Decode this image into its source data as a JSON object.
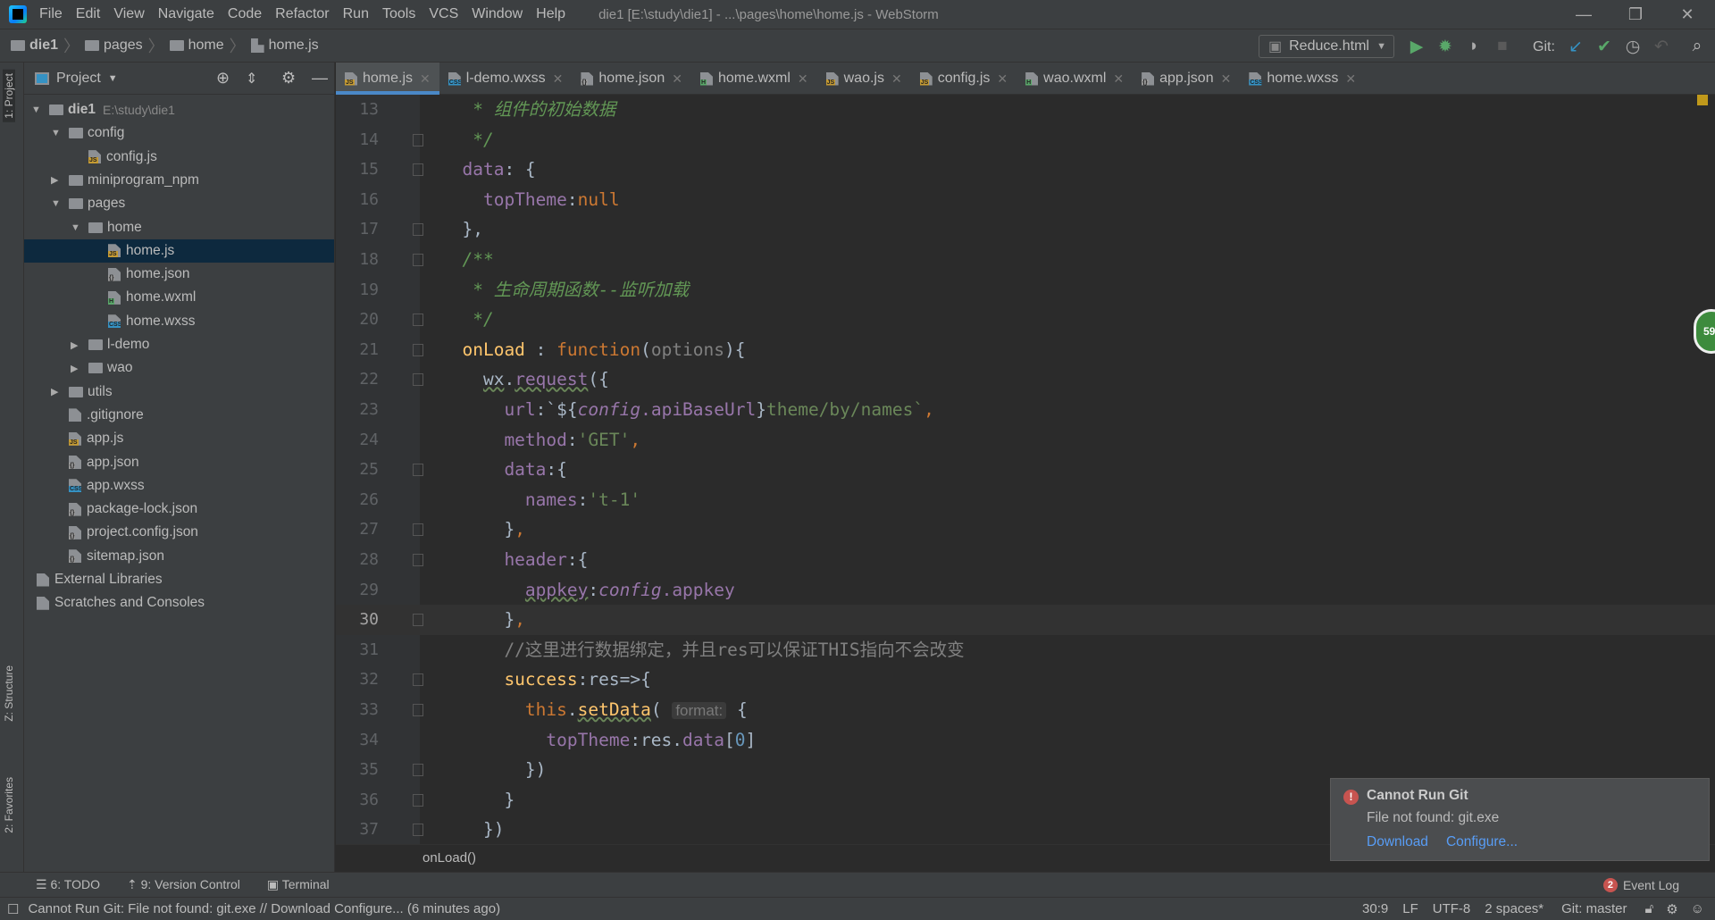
{
  "app": {
    "menus": [
      "File",
      "Edit",
      "View",
      "Navigate",
      "Code",
      "Refactor",
      "Run",
      "Tools",
      "VCS",
      "Window",
      "Help"
    ],
    "title": "die1 [E:\\study\\die1] - ...\\pages\\home\\home.js - WebStorm"
  },
  "breadcrumb": [
    "die1",
    "pages",
    "home",
    "home.js"
  ],
  "toolbar": {
    "run_config": "Reduce.html",
    "git_label": "Git:"
  },
  "side_tabs": {
    "project": "1: Project",
    "structure": "Z: Structure",
    "favorites": "2: Favorites"
  },
  "project": {
    "title": "Project",
    "items": [
      {
        "label": "die1",
        "hint": "E:\\study\\die1",
        "depth": 0,
        "kind": "folder",
        "arrow": "open",
        "bold": true
      },
      {
        "label": "config",
        "depth": 1,
        "kind": "folder",
        "arrow": "open"
      },
      {
        "label": "config.js",
        "depth": 2,
        "kind": "js"
      },
      {
        "label": "miniprogram_npm",
        "depth": 1,
        "kind": "folder",
        "arrow": "closed"
      },
      {
        "label": "pages",
        "depth": 1,
        "kind": "folder",
        "arrow": "open"
      },
      {
        "label": "home",
        "depth": 2,
        "kind": "folder",
        "arrow": "open"
      },
      {
        "label": "home.js",
        "depth": 3,
        "kind": "js",
        "selected": true
      },
      {
        "label": "home.json",
        "depth": 3,
        "kind": "json"
      },
      {
        "label": "home.wxml",
        "depth": 3,
        "kind": "wxml"
      },
      {
        "label": "home.wxss",
        "depth": 3,
        "kind": "css"
      },
      {
        "label": "l-demo",
        "depth": 2,
        "kind": "folder",
        "arrow": "closed"
      },
      {
        "label": "wao",
        "depth": 2,
        "kind": "folder",
        "arrow": "closed"
      },
      {
        "label": "utils",
        "depth": 1,
        "kind": "folder",
        "arrow": "closed"
      },
      {
        "label": ".gitignore",
        "depth": 1,
        "kind": "file"
      },
      {
        "label": "app.js",
        "depth": 1,
        "kind": "js"
      },
      {
        "label": "app.json",
        "depth": 1,
        "kind": "json"
      },
      {
        "label": "app.wxss",
        "depth": 1,
        "kind": "css"
      },
      {
        "label": "package-lock.json",
        "depth": 1,
        "kind": "json"
      },
      {
        "label": "project.config.json",
        "depth": 1,
        "kind": "json"
      },
      {
        "label": "sitemap.json",
        "depth": 1,
        "kind": "json"
      },
      {
        "label": "External Libraries",
        "depth": 0,
        "kind": "lib"
      },
      {
        "label": "Scratches and Consoles",
        "depth": 0,
        "kind": "scratch"
      }
    ]
  },
  "tabs": [
    {
      "label": "home.js",
      "kind": "js",
      "active": true
    },
    {
      "label": "l-demo.wxss",
      "kind": "css"
    },
    {
      "label": "home.json",
      "kind": "json"
    },
    {
      "label": "home.wxml",
      "kind": "wxml"
    },
    {
      "label": "wao.js",
      "kind": "js"
    },
    {
      "label": "config.js",
      "kind": "js"
    },
    {
      "label": "wao.wxml",
      "kind": "wxml"
    },
    {
      "label": "app.json",
      "kind": "json"
    },
    {
      "label": "home.wxss",
      "kind": "css"
    }
  ],
  "code": {
    "current_line": 30,
    "lines": [
      {
        "n": 13,
        "t": [
          [
            "   * 组件的初始数据",
            "d"
          ]
        ]
      },
      {
        "n": 14,
        "t": [
          [
            "   */",
            "d"
          ]
        ]
      },
      {
        "n": 15,
        "t": [
          [
            "  data",
            "p"
          ],
          [
            ": {",
            "t"
          ]
        ]
      },
      {
        "n": 16,
        "t": [
          [
            "    topTheme",
            "p"
          ],
          [
            ":",
            "t"
          ],
          [
            "null",
            "k"
          ]
        ]
      },
      {
        "n": 17,
        "t": [
          [
            "  },",
            "t"
          ]
        ]
      },
      {
        "n": 18,
        "t": [
          [
            "  /**",
            "d"
          ]
        ]
      },
      {
        "n": 19,
        "t": [
          [
            "   * 生命周期函数--监听加载",
            "d"
          ]
        ]
      },
      {
        "n": 20,
        "t": [
          [
            "   */",
            "d"
          ]
        ]
      },
      {
        "n": 21,
        "t": [
          [
            "  onLoad",
            "f"
          ],
          [
            " : ",
            "t"
          ],
          [
            "function",
            "k"
          ],
          [
            "(",
            "t"
          ],
          [
            "options",
            "c"
          ],
          [
            "){",
            "t"
          ]
        ]
      },
      {
        "n": 22,
        "t": [
          [
            "    ",
            "t"
          ],
          [
            "wx",
            "t w"
          ],
          [
            ".",
            "t"
          ],
          [
            "request",
            "p w"
          ],
          [
            "({",
            "t"
          ]
        ]
      },
      {
        "n": 23,
        "t": [
          [
            "      url",
            "p"
          ],
          [
            ":`${",
            "t"
          ],
          [
            "config",
            "p i"
          ],
          [
            ".apiBaseUrl",
            "p"
          ],
          [
            "}",
            "t"
          ],
          [
            "theme/by/names`",
            "s"
          ],
          [
            ",",
            "k"
          ]
        ]
      },
      {
        "n": 24,
        "t": [
          [
            "      method",
            "p"
          ],
          [
            ":",
            "t"
          ],
          [
            "'GET'",
            "s"
          ],
          [
            ",",
            "k"
          ]
        ]
      },
      {
        "n": 25,
        "t": [
          [
            "      data",
            "p"
          ],
          [
            ":{",
            "t"
          ]
        ]
      },
      {
        "n": 26,
        "t": [
          [
            "        names",
            "p"
          ],
          [
            ":",
            "t"
          ],
          [
            "'t-1'",
            "s"
          ]
        ]
      },
      {
        "n": 27,
        "t": [
          [
            "      }",
            "t"
          ],
          [
            ",",
            "k"
          ]
        ]
      },
      {
        "n": 28,
        "t": [
          [
            "      header",
            "p"
          ],
          [
            ":{",
            "t"
          ]
        ]
      },
      {
        "n": 29,
        "t": [
          [
            "        ",
            "t"
          ],
          [
            "appkey",
            "p w"
          ],
          [
            ":",
            "t"
          ],
          [
            "config",
            "p i"
          ],
          [
            ".appkey",
            "p"
          ]
        ]
      },
      {
        "n": 30,
        "t": [
          [
            "      }",
            "t"
          ],
          [
            ",",
            "k"
          ]
        ]
      },
      {
        "n": 31,
        "t": [
          [
            "      //这里进行数据绑定，并且res可以保证THIS指向不会改变",
            "c"
          ]
        ]
      },
      {
        "n": 32,
        "t": [
          [
            "      success",
            "f"
          ],
          [
            ":res=>{",
            "t"
          ]
        ]
      },
      {
        "n": 33,
        "t": [
          [
            "        ",
            "t"
          ],
          [
            "this",
            "k"
          ],
          [
            ".",
            "t"
          ],
          [
            "setData",
            "f w"
          ],
          [
            "( ",
            "t"
          ],
          [
            "format:",
            "hint"
          ],
          [
            " {",
            "t"
          ]
        ]
      },
      {
        "n": 34,
        "t": [
          [
            "          topTheme",
            "p"
          ],
          [
            ":res.",
            "t"
          ],
          [
            "data",
            "p"
          ],
          [
            "[",
            "t"
          ],
          [
            "0",
            "b"
          ],
          [
            "]",
            "t"
          ]
        ]
      },
      {
        "n": 35,
        "t": [
          [
            "        })",
            "t"
          ]
        ]
      },
      {
        "n": 36,
        "t": [
          [
            "      }",
            "t"
          ]
        ]
      },
      {
        "n": 37,
        "t": [
          [
            "    })",
            "t"
          ]
        ]
      }
    ]
  },
  "editor_breadcrumb": "onLoad()",
  "inspection_count": "59",
  "notification": {
    "title": "Cannot Run Git",
    "message": "File not found: git.exe",
    "actions": [
      "Download",
      "Configure..."
    ]
  },
  "bottom_tools": [
    "6: TODO",
    "9: Version Control",
    "Terminal"
  ],
  "event_log": {
    "count": "2",
    "label": "Event Log"
  },
  "status": {
    "message": "Cannot Run Git: File not found: git.exe // Download   Configure... (6 minutes ago)",
    "position": "30:9",
    "line_sep": "LF",
    "encoding": "UTF-8",
    "indent": "2 spaces*",
    "branch": "Git: master"
  },
  "colors": {
    "accent": "#4a88c7",
    "keyword": "#cc7832",
    "property": "#9876aa",
    "string": "#6a8759",
    "comment": "#808080",
    "doc": "#629755",
    "function": "#ffc66d",
    "error": "#c75450",
    "link": "#589df6"
  }
}
